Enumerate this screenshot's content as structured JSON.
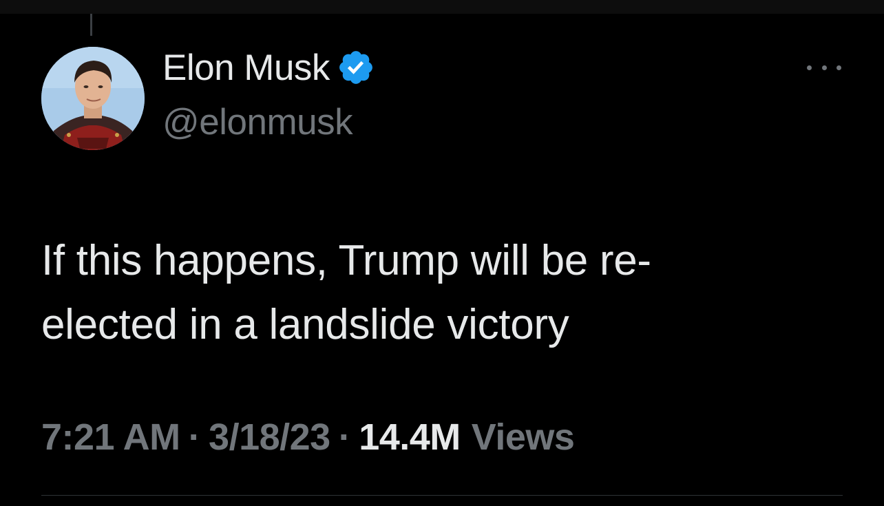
{
  "tweet": {
    "author": {
      "display_name": "Elon Musk",
      "handle": "@elonmusk",
      "verified": true,
      "avatar_icon": "profile-photo",
      "verified_icon": "verified-badge-icon",
      "verified_color": "#1d9bf0"
    },
    "text_lines": [
      "If this happens, Trump will be re-",
      "elected in a landslide victory"
    ],
    "time": "7:21 AM",
    "separator": "·",
    "date": "3/18/23",
    "views_count": "14.4M",
    "views_label": "Views",
    "more_icon": "more-options-icon"
  },
  "theme": {
    "background": "#000000",
    "text_primary": "#e7e9ea",
    "text_secondary": "#71767b",
    "divider": "#2f3336"
  }
}
